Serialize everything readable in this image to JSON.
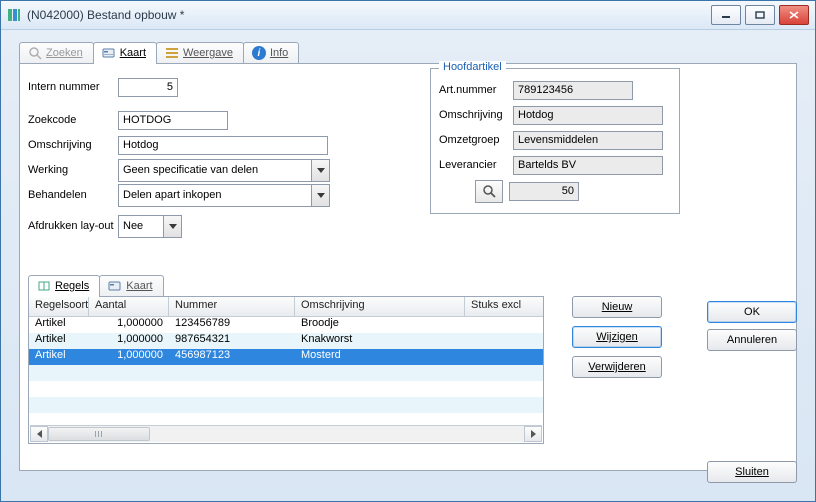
{
  "window": {
    "title": "(N042000) Bestand opbouw *"
  },
  "tabs": {
    "zoeken": "Zoeken",
    "kaart": "Kaart",
    "weergave": "Weergave",
    "info": "Info"
  },
  "form": {
    "intern_nummer_label": "Intern nummer",
    "intern_nummer_value": "5",
    "zoekcode_label": "Zoekcode",
    "zoekcode_value": "HOTDOG",
    "omschrijving_label": "Omschrijving",
    "omschrijving_value": "Hotdog",
    "werking_label": "Werking",
    "werking_value": "Geen specificatie van delen",
    "behandelen_label": "Behandelen",
    "behandelen_value": "Delen apart inkopen",
    "afdrukken_label": "Afdrukken lay-out",
    "afdrukken_value": "Nee"
  },
  "hoofdartikel": {
    "legend": "Hoofdartikel",
    "artnummer_label": "Art.nummer",
    "artnummer_value": "789123456",
    "omschrijving_label": "Omschrijving",
    "omschrijving_value": "Hotdog",
    "omzetgroep_label": "Omzetgroep",
    "omzetgroep_value": "Levensmiddelen",
    "leverancier_label": "Leverancier",
    "leverancier_value": "Bartelds BV",
    "qty_value": "50"
  },
  "subtabs": {
    "regels": "Regels",
    "kaart": "Kaart"
  },
  "grid": {
    "headers": {
      "regelsoort": "Regelsoort",
      "aantal": "Aantal",
      "nummer": "Nummer",
      "omschrijving": "Omschrijving",
      "stuks": "Stuks excl"
    },
    "rows": [
      {
        "soort": "Artikel",
        "aantal": "1,000000",
        "nummer": "123456789",
        "omschrijving": "Broodje",
        "stuks": ""
      },
      {
        "soort": "Artikel",
        "aantal": "1,000000",
        "nummer": "987654321",
        "omschrijving": "Knakworst",
        "stuks": ""
      },
      {
        "soort": "Artikel",
        "aantal": "1,000000",
        "nummer": "456987123",
        "omschrijving": "Mosterd",
        "stuks": ""
      }
    ],
    "selected_index": 2
  },
  "sidebtns": {
    "nieuw": "Nieuw",
    "wijzigen": "Wijzigen",
    "verwijderen": "Verwijderen"
  },
  "footer": {
    "ok": "OK",
    "annuleren": "Annuleren",
    "sluiten": "Sluiten"
  }
}
